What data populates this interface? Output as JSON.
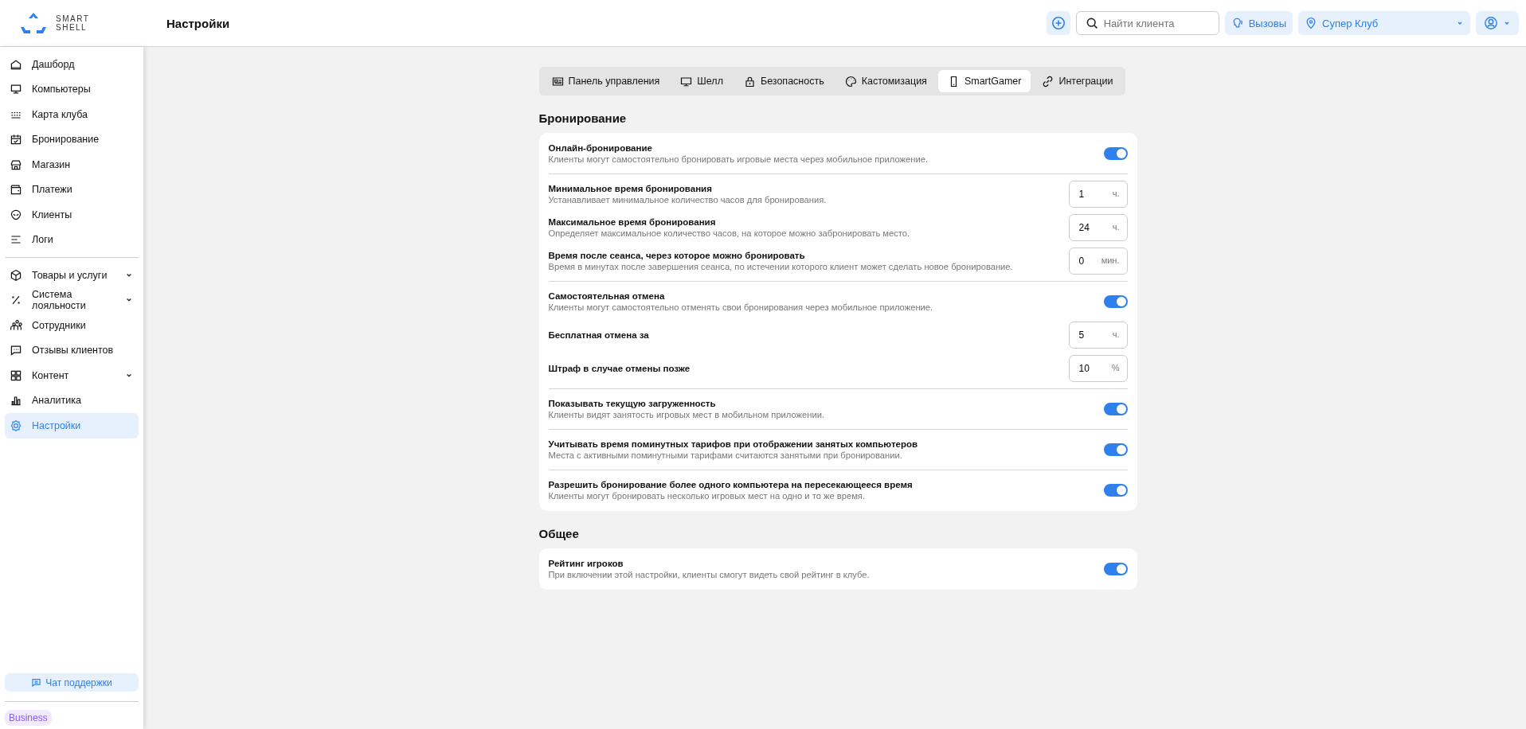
{
  "header": {
    "logo_text": [
      "SMART",
      "SHELL"
    ],
    "title": "Настройки",
    "search": {
      "placeholder": "Найти клиента"
    },
    "calls_button": "Вызовы",
    "club_select": "Супер Клуб"
  },
  "sidebar": {
    "groups": [
      {
        "items": [
          {
            "label": "Дашборд",
            "selected": false
          },
          {
            "label": "Компьютеры",
            "selected": false
          },
          {
            "label": "Карта клуба",
            "selected": false
          },
          {
            "label": "Бронирование",
            "selected": false
          },
          {
            "label": "Магазин",
            "selected": false
          },
          {
            "label": "Платежи",
            "selected": false
          },
          {
            "label": "Клиенты",
            "selected": false
          },
          {
            "label": "Логи",
            "selected": false
          }
        ]
      },
      {
        "items": [
          {
            "label": "Товары и услуги",
            "selected": false,
            "expandable": true
          },
          {
            "label": "Система лояльности",
            "selected": false,
            "expandable": true
          },
          {
            "label": "Сотрудники",
            "selected": false
          },
          {
            "label": "Отзывы клиентов",
            "selected": false
          },
          {
            "label": "Контент",
            "selected": false,
            "expandable": true
          },
          {
            "label": "Аналитика",
            "selected": false
          },
          {
            "label": "Настройки",
            "selected": true
          }
        ]
      }
    ],
    "support_button": "Чат поддержки",
    "plan_badge": "Business"
  },
  "tabs": [
    {
      "label": "Панель управления",
      "selected": false
    },
    {
      "label": "Шелл",
      "selected": false
    },
    {
      "label": "Безопасность",
      "selected": false
    },
    {
      "label": "Кастомизация",
      "selected": false
    },
    {
      "label": "SmartGamer",
      "selected": true
    },
    {
      "label": "Интеграции",
      "selected": false
    }
  ],
  "sections": [
    {
      "title": "Бронирование",
      "groups": [
        {
          "rows": [
            {
              "kind": "toggle",
              "title": "Онлайн-бронирование",
              "description": "Клиенты могут самостоятельно бронировать игровые места через мобильное приложение.",
              "on": true
            }
          ]
        },
        {
          "rows": [
            {
              "kind": "number",
              "title": "Минимальное время бронирования",
              "description": "Устанавливает минимальное количество часов для бронирования.",
              "value": "1",
              "unit": "ч."
            },
            {
              "kind": "number",
              "title": "Максимальное время бронирования",
              "description": "Определяет максимальное количество часов, на которое можно забронировать место.",
              "value": "24",
              "unit": "ч."
            },
            {
              "kind": "number",
              "title": "Время после сеанса, через которое можно бронировать",
              "description": "Время в минутах после завершения сеанса, по истечении которого клиент может сделать новое бронирование.",
              "value": "0",
              "unit": "мин."
            }
          ]
        },
        {
          "rows": [
            {
              "kind": "toggle",
              "title": "Самостоятельная отмена",
              "description": "Клиенты могут самостоятельно отменять свои бронирования через мобильное приложение.",
              "on": true
            },
            {
              "kind": "number",
              "title": "Бесплатная отмена за",
              "value": "5",
              "unit": "ч."
            },
            {
              "kind": "number",
              "title": "Штраф в случае отмены позже",
              "value": "10",
              "unit": "%"
            }
          ]
        },
        {
          "rows": [
            {
              "kind": "toggle",
              "title": "Показывать текущую загруженность",
              "description": "Клиенты видят занятость игровых мест в мобильном приложении.",
              "on": true
            }
          ]
        },
        {
          "rows": [
            {
              "kind": "toggle",
              "title": "Учитывать время поминутных тарифов при отображении занятых компьютеров",
              "description": "Места с активными поминутными тарифами считаются занятыми при бронировании.",
              "on": true
            }
          ]
        },
        {
          "rows": [
            {
              "kind": "toggle",
              "title": "Разрешить бронирование более одного компьютера на пересекающееся время",
              "description": "Клиенты могут бронировать несколько игровых мест на одно и то же время.",
              "on": true
            }
          ]
        }
      ]
    },
    {
      "title": "Общее",
      "groups": [
        {
          "rows": [
            {
              "kind": "toggle",
              "title": "Рейтинг игроков",
              "description": "При включении этой настройки, клиенты смогут видеть свой рейтинг в клубе.",
              "on": true
            }
          ]
        }
      ]
    }
  ]
}
